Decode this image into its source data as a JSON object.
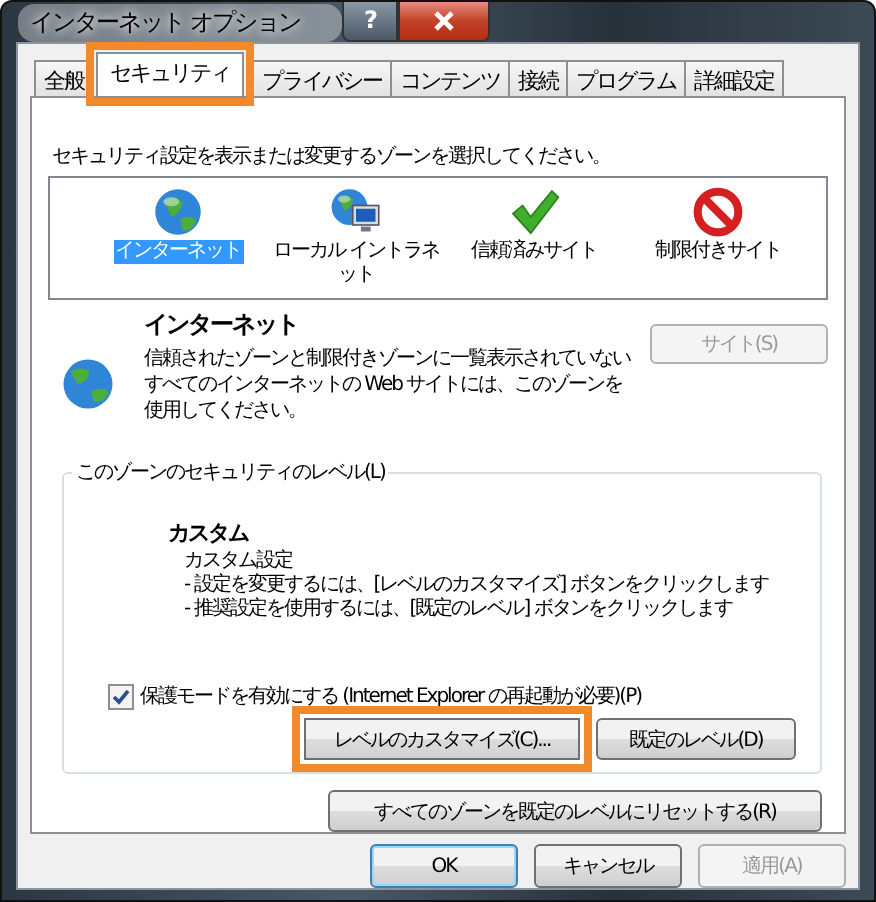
{
  "window": {
    "title": "インターネット オプション",
    "help_button": "?"
  },
  "tabs": [
    {
      "label": "全般",
      "selected": false,
      "highlighted": false
    },
    {
      "label": "セキュリティ",
      "selected": true,
      "highlighted": true
    },
    {
      "label": "プライバシー",
      "selected": false,
      "highlighted": false
    },
    {
      "label": "コンテンツ",
      "selected": false,
      "highlighted": false
    },
    {
      "label": "接続",
      "selected": false,
      "highlighted": false
    },
    {
      "label": "プログラム",
      "selected": false,
      "highlighted": false
    },
    {
      "label": "詳細設定",
      "selected": false,
      "highlighted": false
    }
  ],
  "instruction": "セキュリティ設定を表示または変更するゾーンを選択してください。",
  "zones": [
    {
      "label": "インターネット",
      "kind": "globe",
      "selected": true
    },
    {
      "label": "ローカル イントラネット",
      "kind": "intranet",
      "selected": false
    },
    {
      "label": "信頼済みサイト",
      "kind": "check",
      "selected": false
    },
    {
      "label": "制限付きサイト",
      "kind": "blocked",
      "selected": false
    }
  ],
  "zone_info": {
    "title": "インターネット",
    "description": "信頼されたゾーンと制限付きゾーンに一覧表示されていないすべてのインターネットの Web サイトには、このゾーンを使用してください。",
    "sites_button": {
      "label": "サイト(S)",
      "disabled": true
    }
  },
  "security_level": {
    "legend": "このゾーンのセキュリティのレベル(L)",
    "level_name": "カスタム",
    "lines": [
      "カスタム設定",
      "- 設定を変更するには、[レベルのカスタマイズ] ボタンをクリックします",
      "- 推奨設定を使用するには、[既定のレベル] ボタンをクリックします"
    ]
  },
  "protected_mode": {
    "label": "保護モードを有効にする (Internet Explorer の再起動が必要)(P)",
    "checked": true
  },
  "level_buttons": [
    {
      "label": "レベルのカスタマイズ(C)...",
      "highlighted": true
    },
    {
      "label": "既定のレベル(D)",
      "highlighted": false
    }
  ],
  "reset_button": "すべてのゾーンを既定のレベルにリセットする(R)",
  "dialog_buttons": [
    {
      "label": "OK",
      "kind": "default",
      "disabled": false
    },
    {
      "label": "キャンセル",
      "kind": "normal",
      "disabled": false
    },
    {
      "label": "適用(A)",
      "kind": "normal",
      "disabled": true
    }
  ]
}
